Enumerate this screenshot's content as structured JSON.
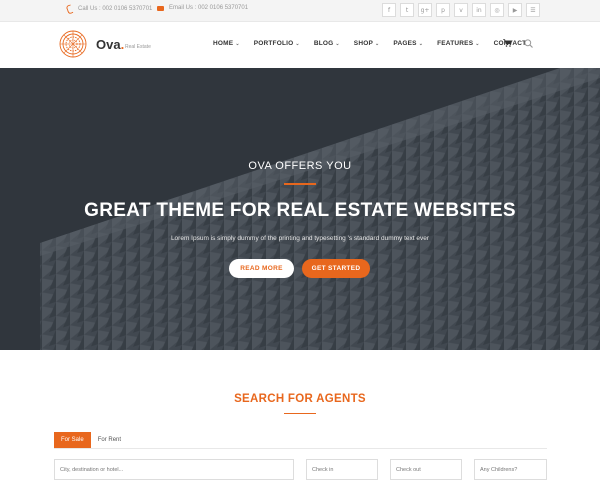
{
  "topbar": {
    "phone": "Call Us : 002 0106 5370701",
    "email": "Email Us : 002 0106 5370701",
    "socials": [
      "f",
      "t",
      "g+",
      "p",
      "v",
      "in",
      "◎",
      "▶",
      "☰"
    ]
  },
  "header": {
    "brand": "Ova",
    "brand_dot": ".",
    "tagline": "Real Estate",
    "nav": [
      {
        "label": "HOME",
        "chevron": true
      },
      {
        "label": "PORTFOLIO",
        "chevron": true
      },
      {
        "label": "BLOG",
        "chevron": true
      },
      {
        "label": "SHOP",
        "chevron": true
      },
      {
        "label": "PAGES",
        "chevron": true
      },
      {
        "label": "FEATURES",
        "chevron": true
      },
      {
        "label": "CONTACT",
        "chevron": false
      }
    ]
  },
  "hero": {
    "subtitle": "OVA OFFERS YOU",
    "title": "GREAT THEME FOR REAL ESTATE WEBSITES",
    "description": "Lorem Ipsum is simply dummy of the printing and typesetting 's standard dummy text ever",
    "read_more": "READ MORE",
    "get_started": "GET STARTED"
  },
  "search": {
    "title": "SEARCH FOR AGENTS",
    "tabs": [
      "For Sale",
      "For Rent"
    ],
    "fields": {
      "destination_placeholder": "City, destination or hotel...",
      "checkin_placeholder": "Check in",
      "checkout_placeholder": "Check out",
      "children_placeholder": "Any Childrens?"
    }
  },
  "colors": {
    "accent": "#e8671d",
    "hero_bg": "#4a525c"
  }
}
